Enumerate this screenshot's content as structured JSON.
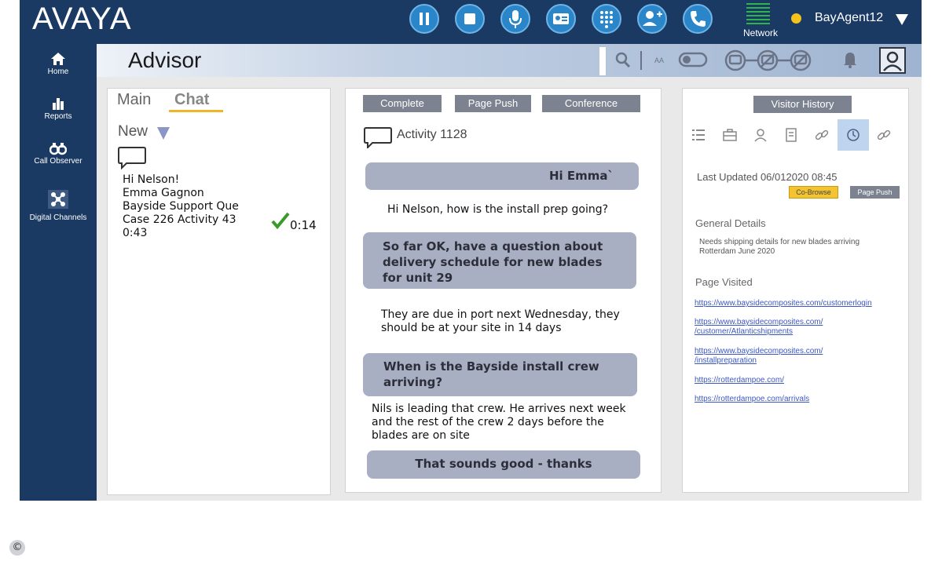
{
  "app": {
    "logo": "AVAYA",
    "page_title": "Advisor"
  },
  "header": {
    "controls": [
      {
        "name": "pause-icon"
      },
      {
        "name": "stop-icon"
      },
      {
        "name": "microphone-icon"
      },
      {
        "name": "contact-card-icon"
      },
      {
        "name": "dialpad-icon"
      },
      {
        "name": "add-user-icon"
      },
      {
        "name": "phone-icon"
      }
    ],
    "network_label": "Network",
    "agent_name": "BayAgent12",
    "status_color": "#f5c21b"
  },
  "nav": {
    "items": [
      {
        "label": "Home",
        "icon": "home-icon"
      },
      {
        "label": "Reports",
        "icon": "bar-chart-icon"
      },
      {
        "label": "Call Observer",
        "icon": "binoculars-icon"
      },
      {
        "label": "Digital Channels",
        "icon": "digital-channels-icon"
      }
    ]
  },
  "left_panel": {
    "tabs": [
      {
        "label": "Main"
      },
      {
        "label": "Chat"
      }
    ],
    "filter_label": "New",
    "conversation": {
      "lines": [
        "Hi Nelson!",
        "Emma Gagnon",
        "Bayside Support Que",
        "Case 226 Activity 43",
        "0:43"
      ],
      "timer": "0:14"
    }
  },
  "middle_panel": {
    "buttons": {
      "complete": "Complete",
      "page_push": "Page Push",
      "conference": "Conference"
    },
    "activity_title": "Activity 1128",
    "messages": {
      "m1": "Hi Emma`",
      "r1": "Hi Nelson, how is the install prep going?",
      "m2": [
        "So far OK, have a question about",
        "delivery schedule for new blades",
        "for unit 29"
      ],
      "r2": [
        "They are due in port next Wednesday, they",
        "should be at your site in 14 days"
      ],
      "m3": [
        "When is the Bayside install crew",
        "arriving?"
      ],
      "r3": [
        "Nils is leading that crew. He arrives next week",
        "and the rest of the crew 2 days before the",
        "blades are on site"
      ],
      "m4": "That sounds good -  thanks"
    }
  },
  "right_panel": {
    "history_button": "Visitor History",
    "last_updated": "Last Updated 06/012020  08:45",
    "cobrowse_button": "Co-Browse",
    "page_push_button": "Page Push",
    "general_details_heading": "General Details",
    "general_details_text": [
      "Needs shipping details for new blades arriving",
      "Rotterdam June 2020"
    ],
    "page_visited_heading": "Page Visited",
    "links": {
      "l1": "https://www.baysidecomposites.com/customerlogin",
      "l2": [
        "https://www.baysidecomposites.com/",
        "/customer/Atlanticshipments"
      ],
      "l3": [
        "https://www.baysidecomposites.com/",
        "/installpreparation"
      ],
      "l4": "https://rotterdampoe.com/",
      "l5": "https://rotterdampoe.com/arrivals"
    }
  },
  "footer": {
    "copyright_symbol": "©"
  }
}
